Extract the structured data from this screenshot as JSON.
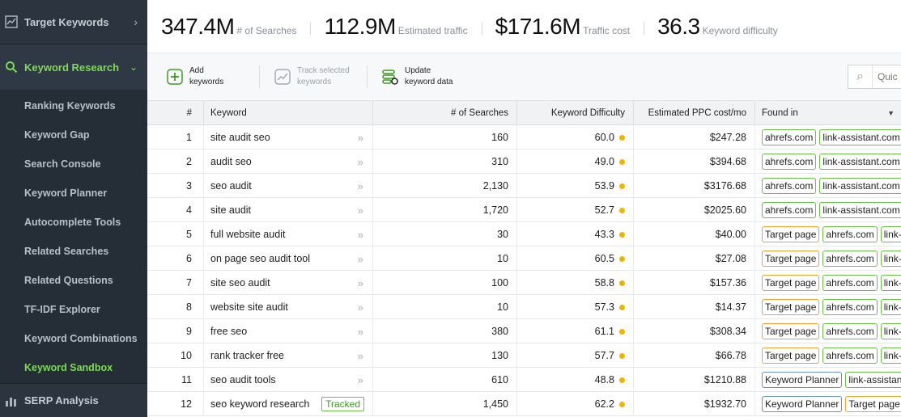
{
  "sidebar": {
    "top_item": "Target Keywords",
    "active_section": "Keyword Research",
    "sub_items": [
      "Ranking Keywords",
      "Keyword Gap",
      "Search Console",
      "Keyword Planner",
      "Autocomplete Tools",
      "Related Searches",
      "Related Questions",
      "TF-IDF Explorer",
      "Keyword Combinations",
      "Keyword Sandbox"
    ],
    "active_sub_item": "Keyword Sandbox",
    "bottom_item": "SERP Analysis"
  },
  "stats": [
    {
      "value": "347.4M",
      "label": "# of Searches"
    },
    {
      "value": "112.9M",
      "label": "Estimated traffic"
    },
    {
      "value": "$171.6M",
      "label": "Traffic cost"
    },
    {
      "value": "36.3",
      "label": "Keyword difficulty"
    }
  ],
  "toolbar": {
    "add_line1": "Add",
    "add_line2": "keywords",
    "track_line1": "Track selected",
    "track_line2": "keywords",
    "update_line1": "Update",
    "update_line2": "keyword data",
    "search_placeholder": "Quic"
  },
  "table": {
    "headers": {
      "num": "#",
      "keyword": "Keyword",
      "searches": "# of Searches",
      "difficulty": "Keyword Difficulty",
      "ppc": "Estimated PPC cost/mo",
      "found": "Found in"
    },
    "rows": [
      {
        "n": "1",
        "kw": "site audit seo",
        "searches": "160",
        "diff": "60.0",
        "ppc": "$247.28",
        "tracked": "",
        "found": [
          {
            "t": "ahrefs.com",
            "c": "green"
          },
          {
            "t": "link-assistant.com",
            "c": "green"
          }
        ]
      },
      {
        "n": "2",
        "kw": "audit seo",
        "searches": "310",
        "diff": "49.0",
        "ppc": "$394.68",
        "tracked": "",
        "found": [
          {
            "t": "ahrefs.com",
            "c": "green"
          },
          {
            "t": "link-assistant.com",
            "c": "green"
          }
        ]
      },
      {
        "n": "3",
        "kw": "seo audit",
        "searches": "2,130",
        "diff": "53.9",
        "ppc": "$3176.68",
        "tracked": "",
        "found": [
          {
            "t": "ahrefs.com",
            "c": "green"
          },
          {
            "t": "link-assistant.com",
            "c": "green"
          }
        ]
      },
      {
        "n": "4",
        "kw": "site audit",
        "searches": "1,720",
        "diff": "52.7",
        "ppc": "$2025.60",
        "tracked": "",
        "found": [
          {
            "t": "ahrefs.com",
            "c": "green"
          },
          {
            "t": "link-assistant.com",
            "c": "green"
          }
        ]
      },
      {
        "n": "5",
        "kw": "full website audit",
        "searches": "30",
        "diff": "43.3",
        "ppc": "$40.00",
        "tracked": "",
        "found": [
          {
            "t": "Target page",
            "c": "orange"
          },
          {
            "t": "ahrefs.com",
            "c": "green"
          },
          {
            "t": "link-assistant.com",
            "c": "green"
          }
        ]
      },
      {
        "n": "6",
        "kw": "on page seo audit tool",
        "searches": "10",
        "diff": "60.5",
        "ppc": "$27.08",
        "tracked": "",
        "found": [
          {
            "t": "Target page",
            "c": "orange"
          },
          {
            "t": "ahrefs.com",
            "c": "green"
          },
          {
            "t": "link-assistant.com",
            "c": "green"
          }
        ]
      },
      {
        "n": "7",
        "kw": "site seo audit",
        "searches": "100",
        "diff": "58.8",
        "ppc": "$157.36",
        "tracked": "",
        "found": [
          {
            "t": "Target page",
            "c": "orange"
          },
          {
            "t": "ahrefs.com",
            "c": "green"
          },
          {
            "t": "link-assistant.com",
            "c": "green"
          }
        ]
      },
      {
        "n": "8",
        "kw": "website site audit",
        "searches": "10",
        "diff": "57.3",
        "ppc": "$14.37",
        "tracked": "",
        "found": [
          {
            "t": "Target page",
            "c": "orange"
          },
          {
            "t": "ahrefs.com",
            "c": "green"
          },
          {
            "t": "link-assistant.com",
            "c": "green"
          }
        ]
      },
      {
        "n": "9",
        "kw": "free seo",
        "searches": "380",
        "diff": "61.1",
        "ppc": "$308.34",
        "tracked": "",
        "found": [
          {
            "t": "Target page",
            "c": "orange"
          },
          {
            "t": "ahrefs.com",
            "c": "green"
          },
          {
            "t": "link-assistant.com",
            "c": "green"
          }
        ]
      },
      {
        "n": "10",
        "kw": "rank tracker free",
        "searches": "130",
        "diff": "57.7",
        "ppc": "$66.78",
        "tracked": "",
        "found": [
          {
            "t": "Target page",
            "c": "orange"
          },
          {
            "t": "ahrefs.com",
            "c": "green"
          },
          {
            "t": "link-assistant.com",
            "c": "green"
          }
        ]
      },
      {
        "n": "11",
        "kw": "seo audit tools",
        "searches": "610",
        "diff": "48.8",
        "ppc": "$1210.88",
        "tracked": "",
        "found": [
          {
            "t": "Keyword Planner",
            "c": "blue"
          },
          {
            "t": "link-assistant.com",
            "c": "green"
          }
        ]
      },
      {
        "n": "12",
        "kw": "seo keyword research",
        "searches": "1,450",
        "diff": "62.2",
        "ppc": "$1932.70",
        "tracked": "Tracked",
        "found": [
          {
            "t": "Keyword Planner",
            "c": "blue"
          },
          {
            "t": "Target page",
            "c": "orange"
          }
        ]
      }
    ]
  },
  "colors": {
    "accent_green": "#7ed957",
    "sidebar_bg": "#252d36",
    "difficulty_dot": "#f0b400",
    "tag_green": "#6abf46",
    "tag_orange": "#f0a030",
    "tag_blue": "#6b8fc9"
  }
}
